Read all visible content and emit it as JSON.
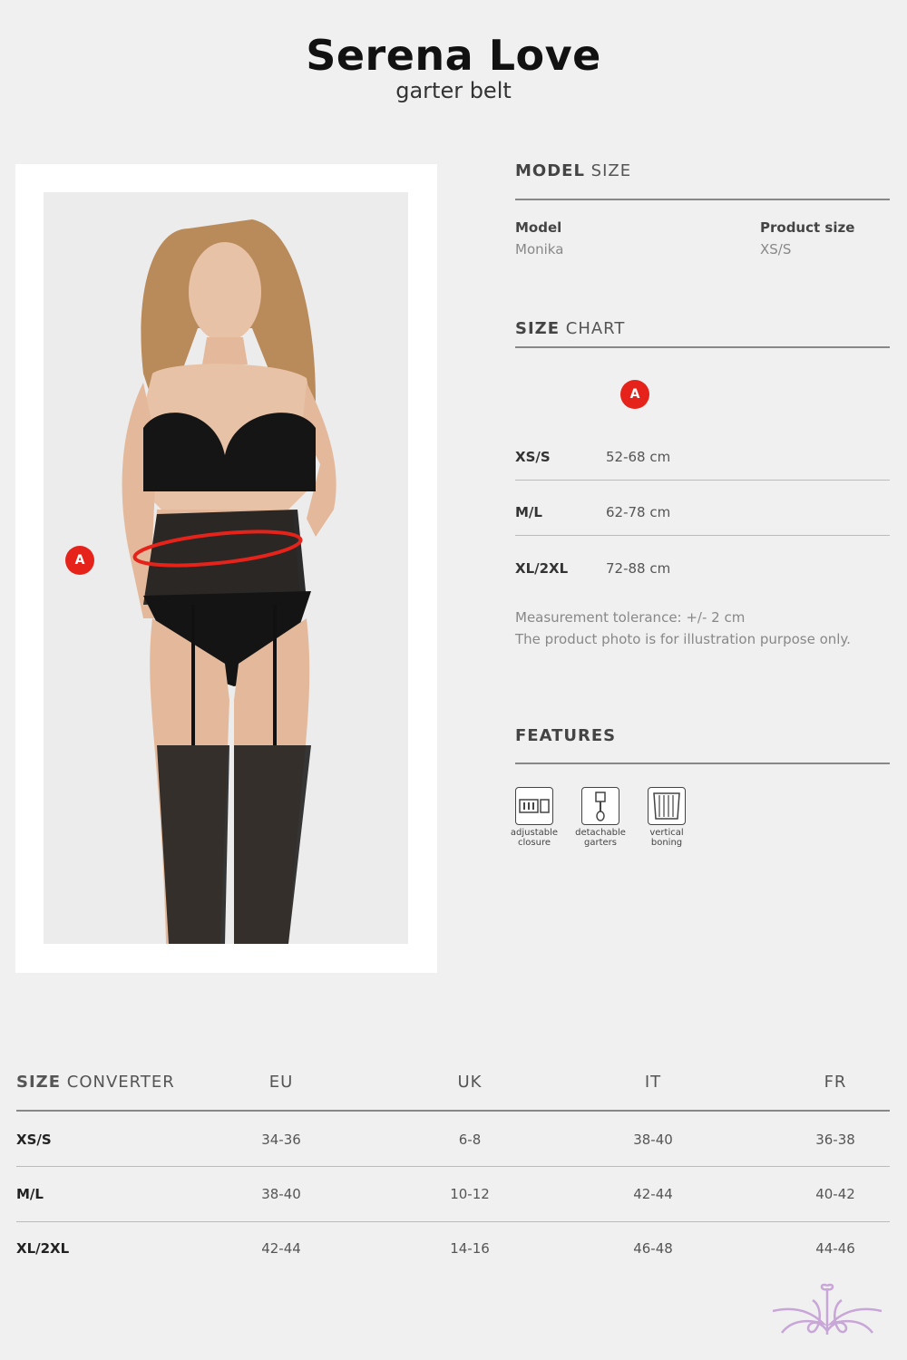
{
  "header": {
    "title": "Serena Love",
    "subtitle": "garter belt"
  },
  "photo": {
    "marker": "A"
  },
  "model_size": {
    "heading_bold": "MODEL",
    "heading_light": "SIZE",
    "model_label": "Model",
    "model_value": "Monika",
    "product_size_label": "Product size",
    "product_size_value": "XS/S"
  },
  "size_chart": {
    "heading_bold": "SIZE",
    "heading_light": "CHART",
    "column_marker": "A",
    "rows": [
      {
        "size": "XS/S",
        "value": "52-68 cm"
      },
      {
        "size": "M/L",
        "value": "62-78 cm"
      },
      {
        "size": "XL/2XL",
        "value": "72-88 cm"
      }
    ],
    "note_1": "Measurement tolerance: +/- 2 cm",
    "note_2": "The product photo is for illustration purpose only."
  },
  "features": {
    "heading": "FEATURES",
    "items": [
      {
        "icon": "adjustable-closure-icon",
        "line1": "adjustable",
        "line2": "closure"
      },
      {
        "icon": "detachable-garters-icon",
        "line1": "detachable",
        "line2": "garters"
      },
      {
        "icon": "vertical-boning-icon",
        "line1": "vertical",
        "line2": "boning"
      }
    ]
  },
  "converter": {
    "heading_bold": "SIZE",
    "heading_light": "CONVERTER",
    "columns": [
      "EU",
      "UK",
      "IT",
      "FR"
    ],
    "rows": [
      {
        "size": "XS/S",
        "values": [
          "34-36",
          "6-8",
          "38-40",
          "36-38"
        ]
      },
      {
        "size": "M/L",
        "values": [
          "38-40",
          "10-12",
          "42-44",
          "40-42"
        ]
      },
      {
        "size": "XL/2XL",
        "values": [
          "42-44",
          "14-16",
          "46-48",
          "44-46"
        ]
      }
    ]
  },
  "colors": {
    "accent": "#e5231b",
    "logo": "#c9a6d8"
  }
}
